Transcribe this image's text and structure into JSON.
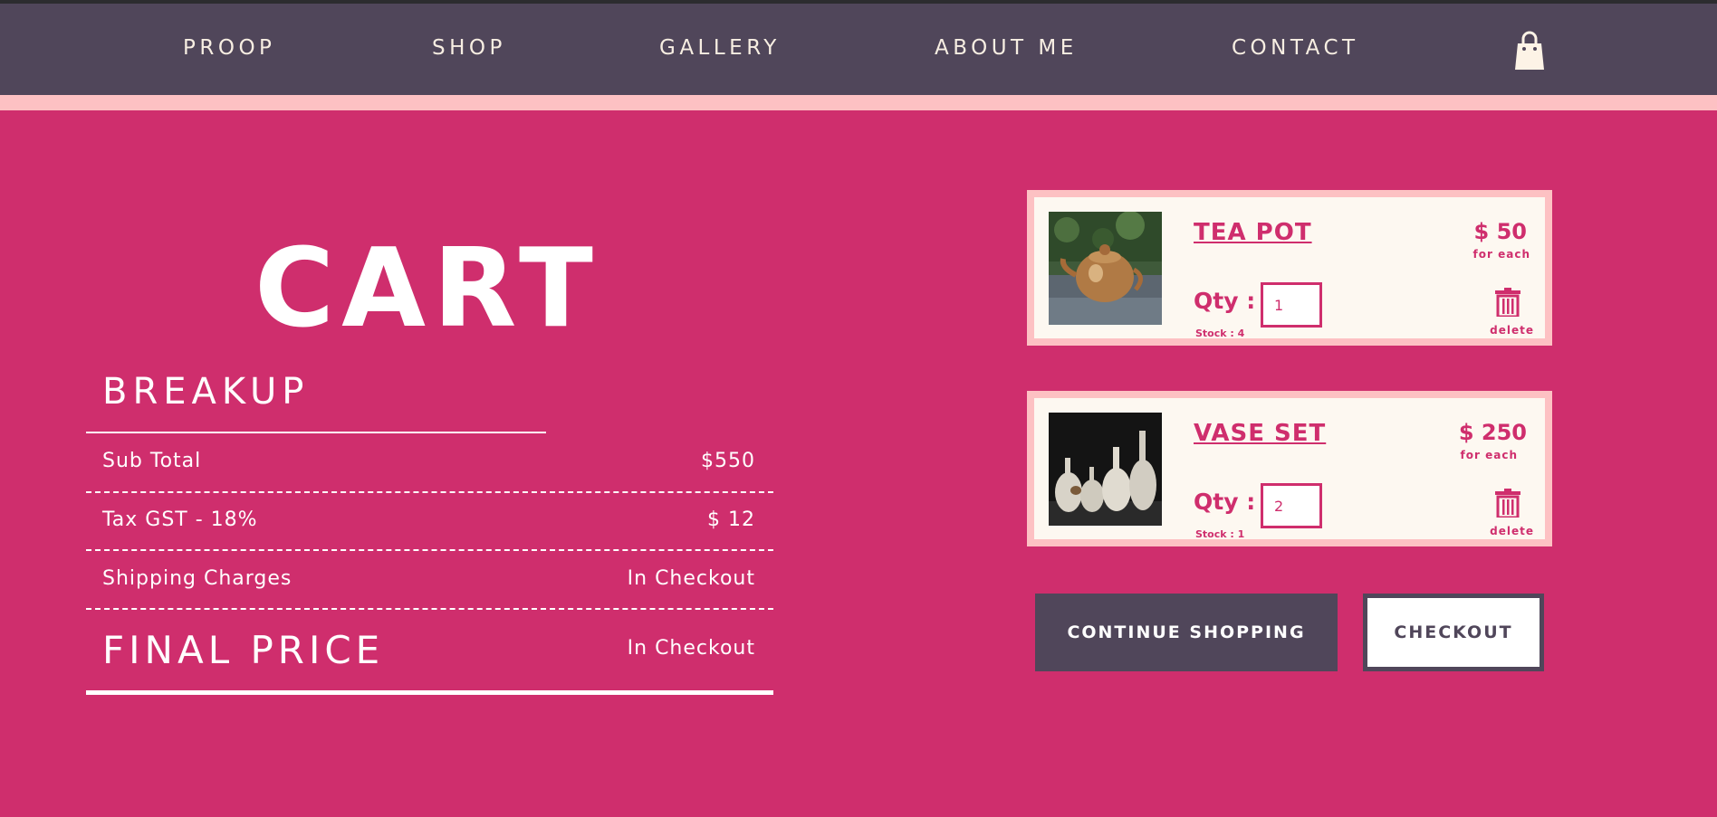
{
  "nav": {
    "items": [
      {
        "label": "PROOP"
      },
      {
        "label": "SHOP"
      },
      {
        "label": "GALLERY"
      },
      {
        "label": "ABOUT ME"
      },
      {
        "label": "CONTACT"
      }
    ],
    "cart_icon": "shopping-bag-icon"
  },
  "page": {
    "title": "CART"
  },
  "breakup": {
    "title": "BREAKUP",
    "rows": [
      {
        "label": "Sub Total",
        "value": "$550"
      },
      {
        "label": "Tax GST - 18%",
        "value": "$ 12"
      },
      {
        "label": "Shipping Charges",
        "value": "In Checkout"
      }
    ],
    "final": {
      "label": "FINAL PRICE",
      "value": "In Checkout"
    }
  },
  "items": [
    {
      "name": "TEA POT",
      "price": "$ 50",
      "price_note": "for each",
      "qty_label": "Qty :",
      "qty": "1",
      "stock": "Stock : 4",
      "delete_label": "delete"
    },
    {
      "name": "VASE SET",
      "price": "$ 250",
      "price_note": "for each",
      "qty_label": "Qty :",
      "qty": "2",
      "stock": "Stock : 1",
      "delete_label": "delete"
    }
  ],
  "actions": {
    "continue_label": "CONTINUE SHOPPING",
    "checkout_label": "CHECKOUT"
  },
  "colors": {
    "background": "#cf2e6d",
    "nav": "#50465a",
    "accent_band": "#fdc1c3",
    "card": "#fdf8f1",
    "text_light": "#f7eee2"
  }
}
